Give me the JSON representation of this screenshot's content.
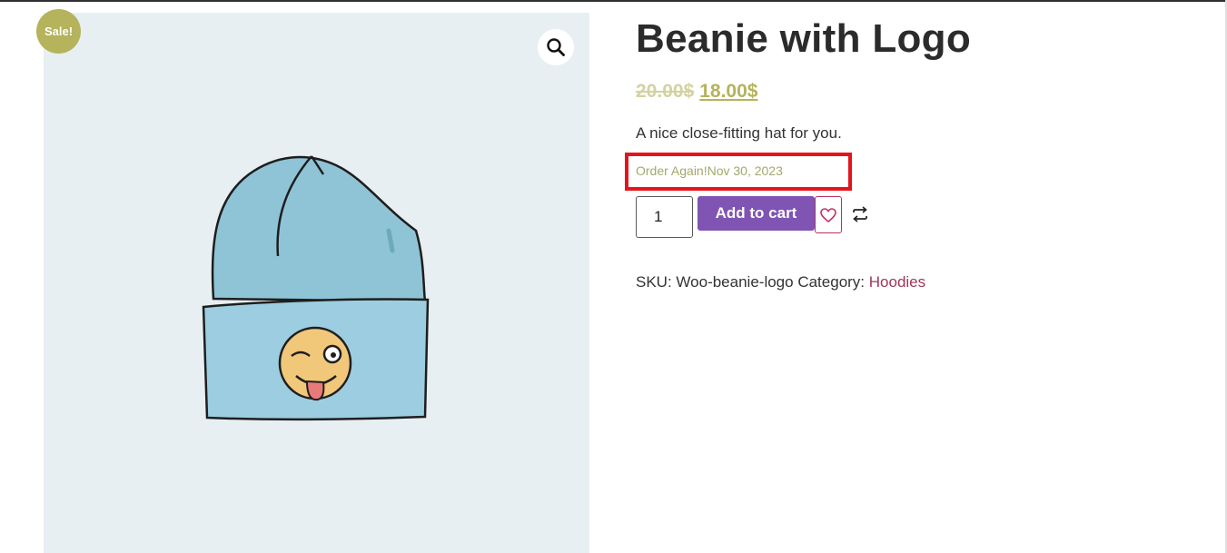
{
  "product": {
    "sale_badge": "Sale!",
    "title": "Beanie with Logo",
    "price_regular": "20.00$",
    "price_sale": "18.00$",
    "short_description": "A nice close-fitting hat for you.",
    "order_again_text": "Order Again!Nov 30, 2023",
    "quantity": "1",
    "add_to_cart_label": "Add to cart",
    "sku_label": "SKU:",
    "sku_value": "Woo-beanie-logo",
    "category_label": "Category:",
    "category_value": "Hoodies"
  },
  "icons": {
    "zoom": "magnifier-icon",
    "wishlist": "heart-icon",
    "compare": "compare-arrows-icon"
  },
  "colors": {
    "sale_badge": "#b5b35b",
    "sale_price": "#b5b35b",
    "add_to_cart": "#7f54b3",
    "category_link": "#a0365b",
    "highlight_box": "#e3151b"
  }
}
